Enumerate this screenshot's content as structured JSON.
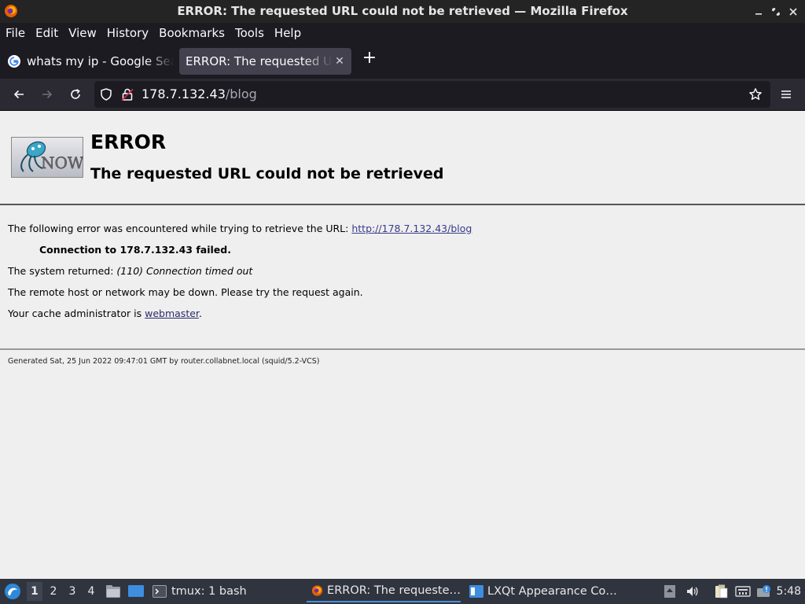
{
  "window": {
    "title": "ERROR: The requested URL could not be retrieved — Mozilla Firefox",
    "controls": [
      "minimize-icon",
      "restore-icon",
      "close-icon"
    ]
  },
  "menubar": [
    "File",
    "Edit",
    "View",
    "History",
    "Bookmarks",
    "Tools",
    "Help"
  ],
  "tabs": [
    {
      "label": "whats my ip - Google Search",
      "favicon": "google-icon",
      "active": false
    },
    {
      "label": "ERROR: The requested URL could not be retrieved",
      "favicon": "none",
      "active": true
    }
  ],
  "navbar": {
    "url_host": "178.7.132.43",
    "url_path": "/blog",
    "icons": [
      "back-icon",
      "forward-icon",
      "reload-icon",
      "shield-icon",
      "lock-icon",
      "bookmark-star-icon",
      "hamburger-menu-icon"
    ]
  },
  "page": {
    "logo": "squid-now-logo",
    "title": "ERROR",
    "subtitle": "The requested URL could not be retrieved",
    "intro": "The following error was encountered while trying to retrieve the URL: ",
    "url_link": "http://178.7.132.43/blog",
    "failed_line": "Connection to 178.7.132.43 failed.",
    "system_prefix": "The system returned: ",
    "system_value": "(110) Connection timed out",
    "remote_msg": "The remote host or network may be down. Please try the request again.",
    "admin_prefix": "Your cache administrator is ",
    "admin_link": "webmaster",
    "admin_suffix": ".",
    "footer": "Generated Sat, 25 Jun 2022 09:47:01 GMT by router.collabnet.local (squid/5.2-VCS)"
  },
  "taskbar": {
    "desktops": [
      "1",
      "2",
      "3",
      "4"
    ],
    "current_desktop": "1",
    "tasks": [
      {
        "label": "tmux: 1 bash",
        "icon": "terminal-icon"
      },
      {
        "label": "ERROR: The requeste…",
        "icon": "firefox-icon"
      },
      {
        "label": "LXQt Appearance Co…",
        "icon": "appearance-icon"
      }
    ],
    "clock": "5:48"
  },
  "colors": {
    "titlebar": "#242424",
    "chrome": "#1c1b22",
    "navbar": "#2b2a33",
    "page": "#efefef",
    "taskbar": "#2f343f",
    "link": "#3a3a8c"
  }
}
